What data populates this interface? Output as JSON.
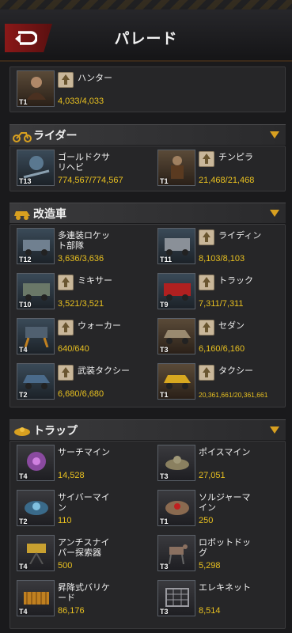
{
  "header": {
    "title": "パレード"
  },
  "hero": {
    "name": "ハンター",
    "tier": "T1",
    "count": "4,033/4,033"
  },
  "sections": {
    "riders": {
      "title": "ライダー"
    },
    "vehicles": {
      "title": "改造車"
    },
    "traps": {
      "title": "トラップ"
    }
  },
  "riders": [
    {
      "name": "ゴールドクサ\nリヘビ",
      "tier": "T13",
      "count": "774,567/774,567"
    },
    {
      "name": "チンピラ",
      "tier": "T1",
      "count": "21,468/21,468"
    }
  ],
  "vehicles": [
    {
      "name": "多連装ロケッ\nト部隊",
      "tier": "T12",
      "count": "3,636/3,636"
    },
    {
      "name": "ライディン",
      "tier": "T11",
      "count": "8,103/8,103"
    },
    {
      "name": "ミキサー",
      "tier": "T10",
      "count": "3,521/3,521"
    },
    {
      "name": "トラック",
      "tier": "T9",
      "count": "7,311/7,311"
    },
    {
      "name": "ウォーカー",
      "tier": "T4",
      "count": "640/640"
    },
    {
      "name": "セダン",
      "tier": "T3",
      "count": "6,160/6,160"
    },
    {
      "name": "武装タクシー",
      "tier": "T2",
      "count": "6,680/6,680"
    },
    {
      "name": "タクシー",
      "tier": "T1",
      "count": "20,361,661/20,361,661"
    }
  ],
  "traps": [
    {
      "name": "サーチマイン",
      "tier": "T4",
      "count": "14,528"
    },
    {
      "name": "ポイスマイン",
      "tier": "T3",
      "count": "27,051"
    },
    {
      "name": "サイバーマイ\nン",
      "tier": "T2",
      "count": "110"
    },
    {
      "name": "ソルジャーマ\nイン",
      "tier": "T1",
      "count": "250"
    },
    {
      "name": "アンチスナイ\nパー探索器",
      "tier": "T4",
      "count": "500"
    },
    {
      "name": "ロボットドッ\nグ",
      "tier": "T3",
      "count": "5,298"
    },
    {
      "name": "昇降式バリケ\nード",
      "tier": "T4",
      "count": "86,176"
    },
    {
      "name": "エレキネット",
      "tier": "T3",
      "count": "8,514"
    }
  ]
}
